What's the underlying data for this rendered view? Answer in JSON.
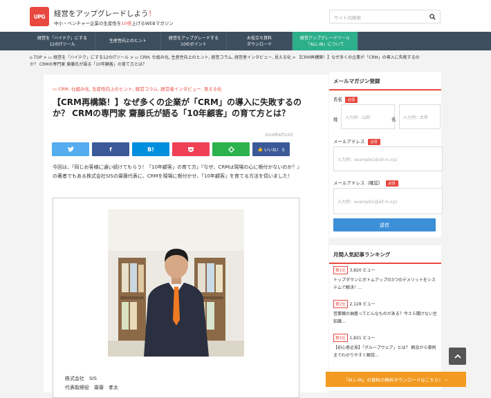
{
  "header": {
    "logo_text": "UPG",
    "title_pre": "経営をアップグレードしよう",
    "title_mark": "！",
    "subtitle_pre": "中小・ベンチャー企業の生産性を",
    "subtitle_em": "10倍",
    "subtitle_post": "上げるWEBマガジン",
    "search_placeholder": "サイト内検索",
    "search_icon": "magnifier-icon"
  },
  "nav": [
    {
      "l1": "経営を「ハイテク」にする",
      "l2": "12のITツール"
    },
    {
      "l1": "生産性向上のヒント",
      "l2": ""
    },
    {
      "l1": "経営をアップグレードする",
      "l2": "10のポイント"
    },
    {
      "l1": "お役立ち資料",
      "l2": "ダウンロード"
    },
    {
      "l1": "経営アップグレードツール",
      "l2": "「ALL-IN」について"
    }
  ],
  "breadcrumb": {
    "home": "TOP",
    "c1": "経営を「ハイテク」にする12のITツール",
    "c2": "CRM, 仕組み化, 生産性向上のヒント, 経営コラム, 経営者インタビュー, 見える化",
    "current_1": "【CRM再構築！】なぜ多くの企業が「CRM」の導入に失敗するの",
    "current_2": "か？ CRMの専門家 齋藤氏が語る「10年顧客」の育て方とは？"
  },
  "article": {
    "categories": "CRM, 仕組み化, 生産性向上のヒント, 経営コラム, 経営者インタビュー, 見える化",
    "title": "【CRM再構築！】なぜ多くの企業が「CRM」の導入に失敗するのか？ CRMの専門家 齋藤氏が語る「10年顧客」の育て方とは？",
    "date": "2018年8月22日",
    "share": {
      "twitter": "twitter-icon",
      "facebook": "facebook-icon",
      "hatena": "B!",
      "pocket": "pocket-icon",
      "feedly": "feedly-icon",
      "like": "いいね！ 0"
    },
    "lead": "今回は、『同じお客様に通い続けてもらう！「10年顧客」の育て方』『なぜ、CRMは現場の心に根付かないのか？』の著者でもある株式会社SISの齋藤代表に、CRMを現場に根付かせ、「10年顧客」を育てる方法を伺いました！",
    "caption_1": "株式会社　SIS",
    "caption_2": "代表取締役　齋藤　孝太"
  },
  "sidebar": {
    "heading": "メールマガジン登録",
    "name_label": "氏名",
    "required": "必須",
    "sei": "姓",
    "mei": "名",
    "sei_placeholder": "入力例：山田",
    "mei_placeholder": "入力例：太郎",
    "email_label": "メールアドレス",
    "email_placeholder": "入力例：example1@all-in.xyz",
    "email2_label": "メールアドレス（確認）",
    "email2_placeholder": "入力例：example1@all-in.xyz",
    "submit": "送信"
  },
  "ranking": {
    "heading": "月間人気記事ランキング",
    "items": [
      {
        "rank": "第1位",
        "views": "3,820 ビュー",
        "text": "トップダウンとボトムアップの3つのデメリットをシステムで解決！..."
      },
      {
        "rank": "第2位",
        "views": "2,128 ビュー",
        "text": "営業職の抽層ってどんなものがある？今さら聞けない豆知識..."
      },
      {
        "rank": "第3位",
        "views": "1,831 ビュー",
        "text": "【初心者必見】「グループウェア」とは？ 概念から事例までわかりやすく解説..."
      }
    ]
  },
  "banner": "「ALL-IN」の資料の無料ダウンロードはこちら！",
  "colors": {
    "accent": "#e8483f",
    "nav": "#3d4e5f",
    "nav_active": "#2daf8c",
    "orange": "#f29a21"
  }
}
